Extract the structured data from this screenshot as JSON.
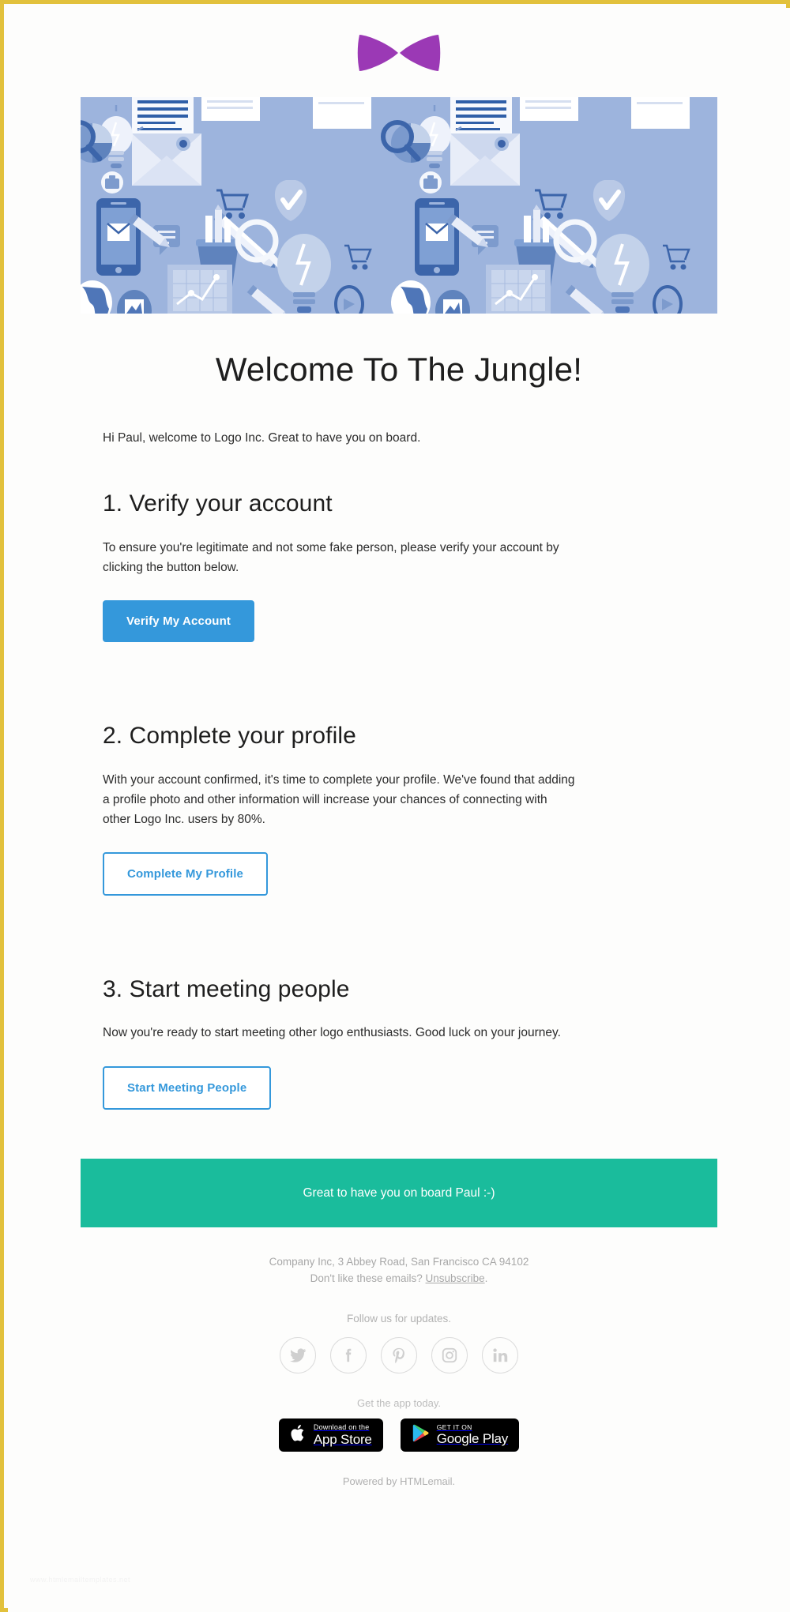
{
  "frame": {
    "border_color": "#e2c13c",
    "background": "#fdfdfb"
  },
  "brand": {
    "logo_icon": "bowtie-logo",
    "logo_color": "#9b39b5"
  },
  "hero": {
    "image_icon": "office-supplies-pattern-banner",
    "background_color": "#9db4dd"
  },
  "content": {
    "title": "Welcome To The Jungle!",
    "lead": "Hi Paul, welcome to Logo Inc. Great to have you on board.",
    "steps": [
      {
        "heading": "1. Verify your account",
        "body": "To ensure you're legitimate and not some fake person, please verify your account by clicking the button below.",
        "button_label": "Verify My Account",
        "button_style": "primary"
      },
      {
        "heading": "2. Complete your profile",
        "body": "With your account confirmed, it's time to complete your profile. We've found that adding a profile photo and other information will increase your chances of connecting with other Logo Inc. users by 80%.",
        "button_label": "Complete My Profile",
        "button_style": "outline"
      },
      {
        "heading": "3. Start meeting people",
        "body": "Now you're ready to start meeting other logo enthusiasts. Good luck on your journey.",
        "button_label": "Start Meeting People",
        "button_style": "outline"
      }
    ]
  },
  "callout": {
    "text": "Great to have you on board Paul :-)",
    "background_color": "#1abc9c",
    "text_color": "#ffffff"
  },
  "footer": {
    "address": "Company Inc, 3 Abbey Road, San Francisco CA 94102",
    "unsubscribe_prefix": "Don't like these emails? ",
    "unsubscribe_label": "Unsubscribe",
    "unsubscribe_suffix": ".",
    "follow_label": "Follow us for updates.",
    "socials": [
      {
        "name": "twitter-icon",
        "label": "Twitter"
      },
      {
        "name": "facebook-icon",
        "label": "Facebook"
      },
      {
        "name": "pinterest-icon",
        "label": "Pinterest"
      },
      {
        "name": "instagram-icon",
        "label": "Instagram"
      },
      {
        "name": "linkedin-icon",
        "label": "LinkedIn"
      }
    ],
    "get_app_label": "Get the app today.",
    "badges": [
      {
        "icon": "apple-icon",
        "top": "Download on the",
        "bottom": "App Store"
      },
      {
        "icon": "google-play-icon",
        "top": "GET IT ON",
        "bottom": "Google Play"
      }
    ],
    "powered_by": "Powered by HTMLemail.",
    "watermark": "www.htmlemailtemplates.net"
  },
  "colors": {
    "accent_blue": "#3498db",
    "accent_green": "#1abc9c",
    "brand_purple": "#9b39b5",
    "gold_border": "#e2c13c"
  }
}
